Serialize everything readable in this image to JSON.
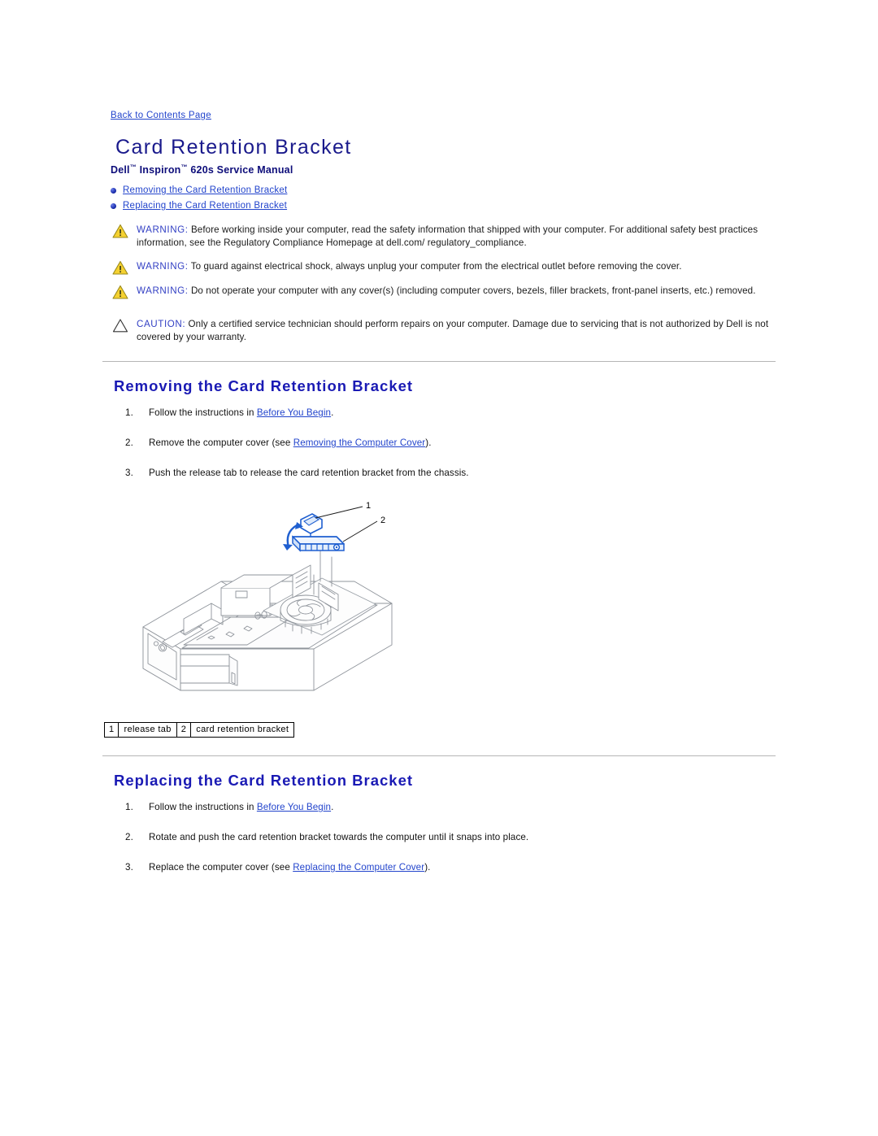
{
  "back_link": "Back to Contents Page",
  "header": {
    "title": "Card Retention Bracket",
    "subtitle_pre": "Dell",
    "subtitle_tm1": "™",
    "subtitle_mid": " Inspiron",
    "subtitle_tm2": "™",
    "subtitle_post": " 620s Service Manual"
  },
  "toc": {
    "items": [
      {
        "label": "Removing the Card Retention Bracket"
      },
      {
        "label": "Replacing the Card Retention Bracket"
      }
    ]
  },
  "notices": [
    {
      "type": "warning",
      "label": "WARNING:",
      "text": " Before working inside your computer, read the safety information that shipped with your computer. For additional safety best practices information, see the Regulatory Compliance Homepage at dell.com/ regulatory_compliance."
    },
    {
      "type": "warning",
      "label": "WARNING:",
      "text": " To guard against electrical shock, always unplug your computer from the electrical outlet before removing the cover."
    },
    {
      "type": "warning",
      "label": "WARNING:",
      "text": " Do not operate your computer with any cover(s) (including computer covers, bezels, filler brackets, front-panel inserts, etc.) removed."
    },
    {
      "type": "caution",
      "label": "CAUTION:",
      "text": " Only a certified service technician should perform repairs on your computer. Damage due to servicing that is not authorized by Dell is not covered by your warranty."
    }
  ],
  "removing": {
    "heading": "Removing the Card Retention Bracket",
    "step1_pre": "Follow the instructions in ",
    "step1_link": "Before You Begin",
    "step1_post": ".",
    "step2_pre": "Remove the computer cover (see ",
    "step2_link": "Removing the Computer Cover",
    "step2_post": ").",
    "step3": "Push the release tab to release the card retention bracket from the chassis."
  },
  "figure": {
    "callout_1": "1",
    "callout_2": "2",
    "legend": [
      {
        "num": "1",
        "label": "release tab"
      },
      {
        "num": "2",
        "label": "card retention bracket"
      }
    ]
  },
  "replacing": {
    "heading": "Replacing the Card Retention Bracket",
    "step1_pre": "Follow the instructions in ",
    "step1_link": "Before You Begin",
    "step1_post": ".",
    "step2": "Rotate and push the card retention bracket towards the computer until it snaps into place.",
    "step3_pre": "Replace the computer cover (see ",
    "step3_link": "Replacing the Computer Cover",
    "step3_post": ")."
  },
  "colors": {
    "title_blue": "#1a1a8c",
    "section_blue": "#1a1ab4",
    "link_blue": "#2244cc",
    "warning_yellow": "#f5d130",
    "highlight_blue": "#1f5fd0"
  }
}
